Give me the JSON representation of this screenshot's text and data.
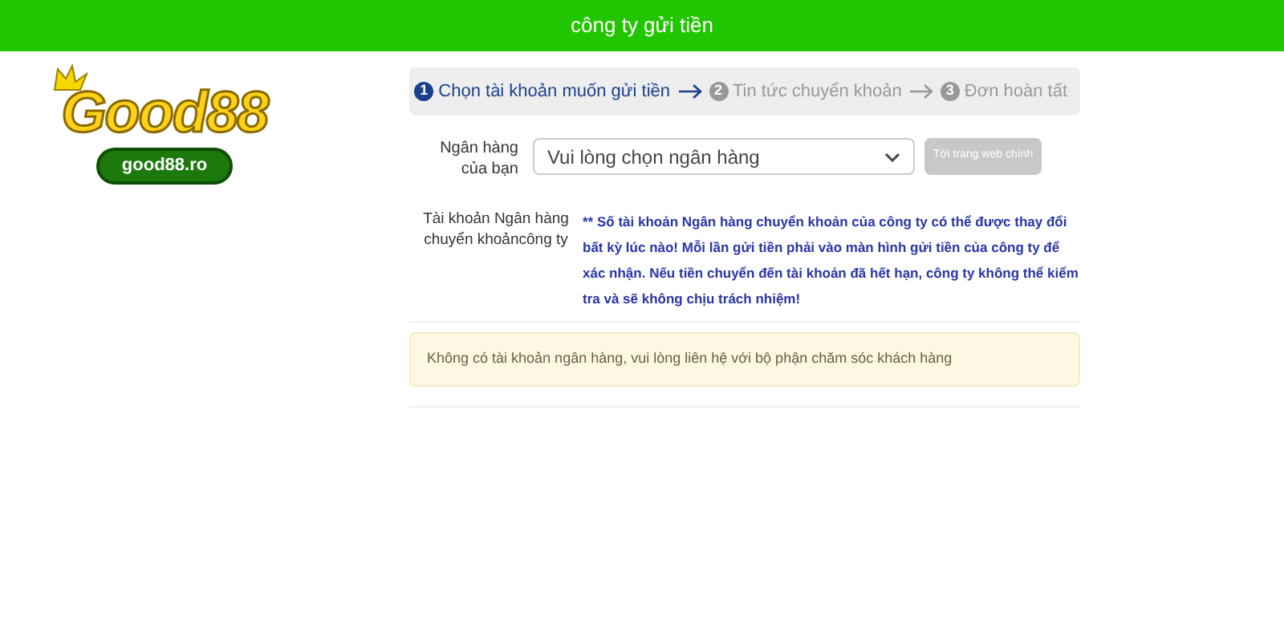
{
  "header": {
    "title": "công ty gửi tiền"
  },
  "logo": {
    "wordmark": "Good88",
    "domain": "good88.ro"
  },
  "steps": [
    {
      "number": "1",
      "label": "Chọn tài khoản muốn gửi tiền",
      "selected": true
    },
    {
      "number": "2",
      "label": "Tin tức chuyển khoản",
      "selected": false
    },
    {
      "number": "3",
      "label": "Đơn hoàn tất",
      "selected": false
    }
  ],
  "bank_field": {
    "label": "Ngân hàng của bạn",
    "placeholder": "Vui lòng chọn ngân hàng"
  },
  "main_site_button": {
    "label": "Tới trang web chính",
    "disabled": true
  },
  "account": {
    "label": "Tài khoản Ngân hàng chuyển khoảncông ty",
    "notice": "** Số tài khoản Ngân hàng chuyển khoản của công ty có thể được thay đổi bất kỳ lúc nào! Mỗi lần gửi tiền phải vào màn hình gửi tiền của công ty để xác nhận. Nếu tiền chuyển đến tài khoản đã hết hạn, công ty không thể kiểm tra và sẽ không chịu trách nhiệm!"
  },
  "alert": {
    "message": "Không có tài khoản ngân hàng, vui lòng liên hệ với bộ phận chăm sóc khách hàng"
  }
}
